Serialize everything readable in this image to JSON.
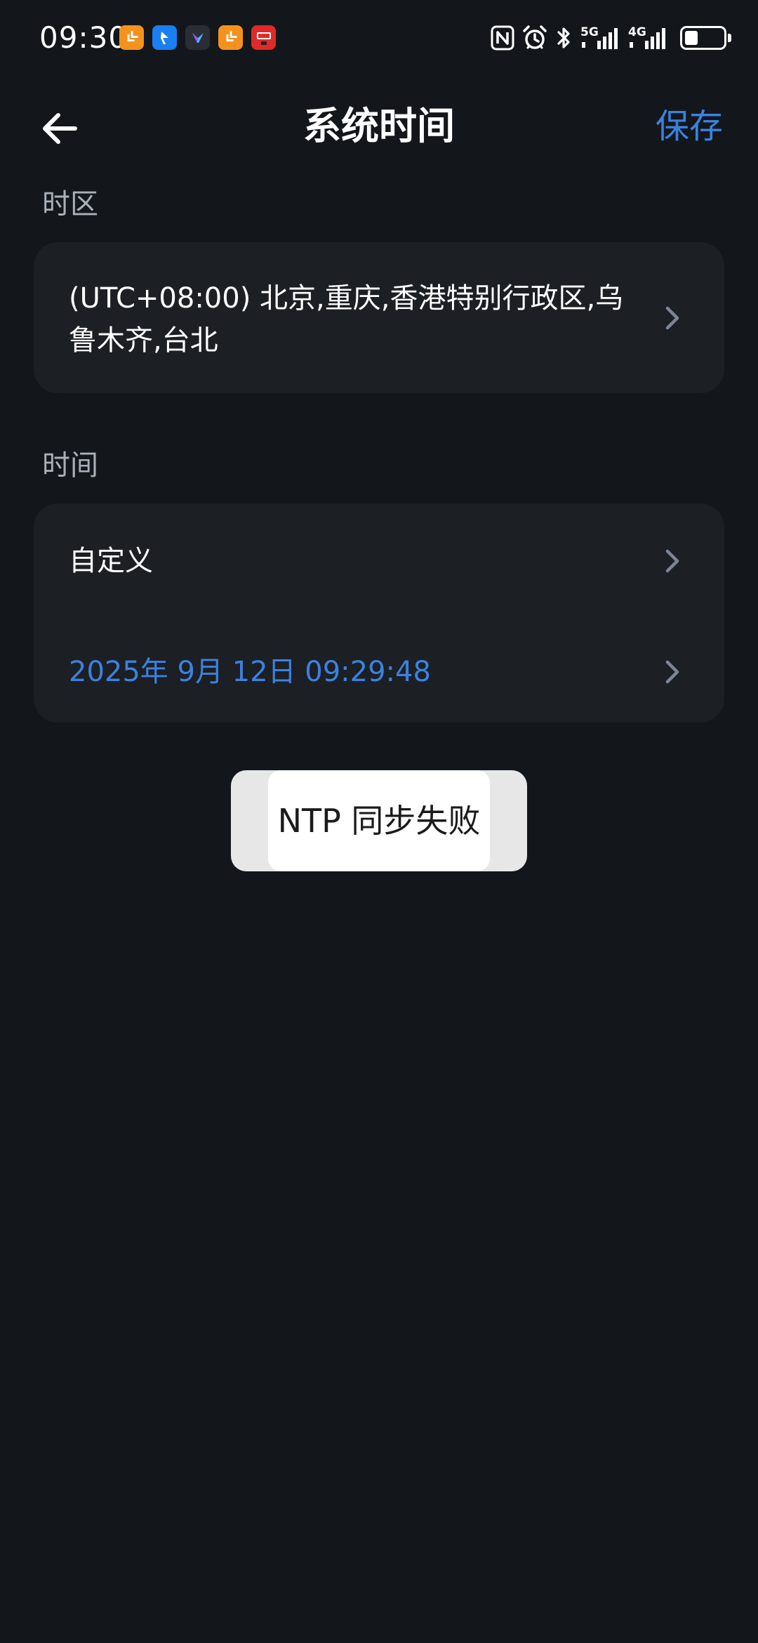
{
  "status_bar": {
    "time": "09:30",
    "notification_icons": [
      "orange-app-icon",
      "blue-app-icon",
      "dark-app-icon",
      "orange-app-icon",
      "red-app-icon"
    ],
    "indicators": [
      "nfc-icon",
      "alarm-icon",
      "bluetooth-icon",
      "signal-5g-icon",
      "signal-4g-icon",
      "battery-icon"
    ],
    "net_5g": "5G",
    "net_4g": "4G"
  },
  "header": {
    "title": "系统时间",
    "save_label": "保存"
  },
  "timezone_section": {
    "label": "时区",
    "value_line1": "(UTC+08:00) 北京,重庆,香港特别行政区,乌",
    "value_line2": "鲁木齐,台北"
  },
  "time_section": {
    "label": "时间",
    "mode": "自定义",
    "datetime": "2025年 9月 12日 09:29:48"
  },
  "toast": {
    "message": "NTP 同步失败"
  },
  "colors": {
    "background": "#13171b",
    "card": "#1c1f24",
    "accent": "#3b82e0",
    "label": "#a9b0ba",
    "chevron": "#7b8596"
  }
}
